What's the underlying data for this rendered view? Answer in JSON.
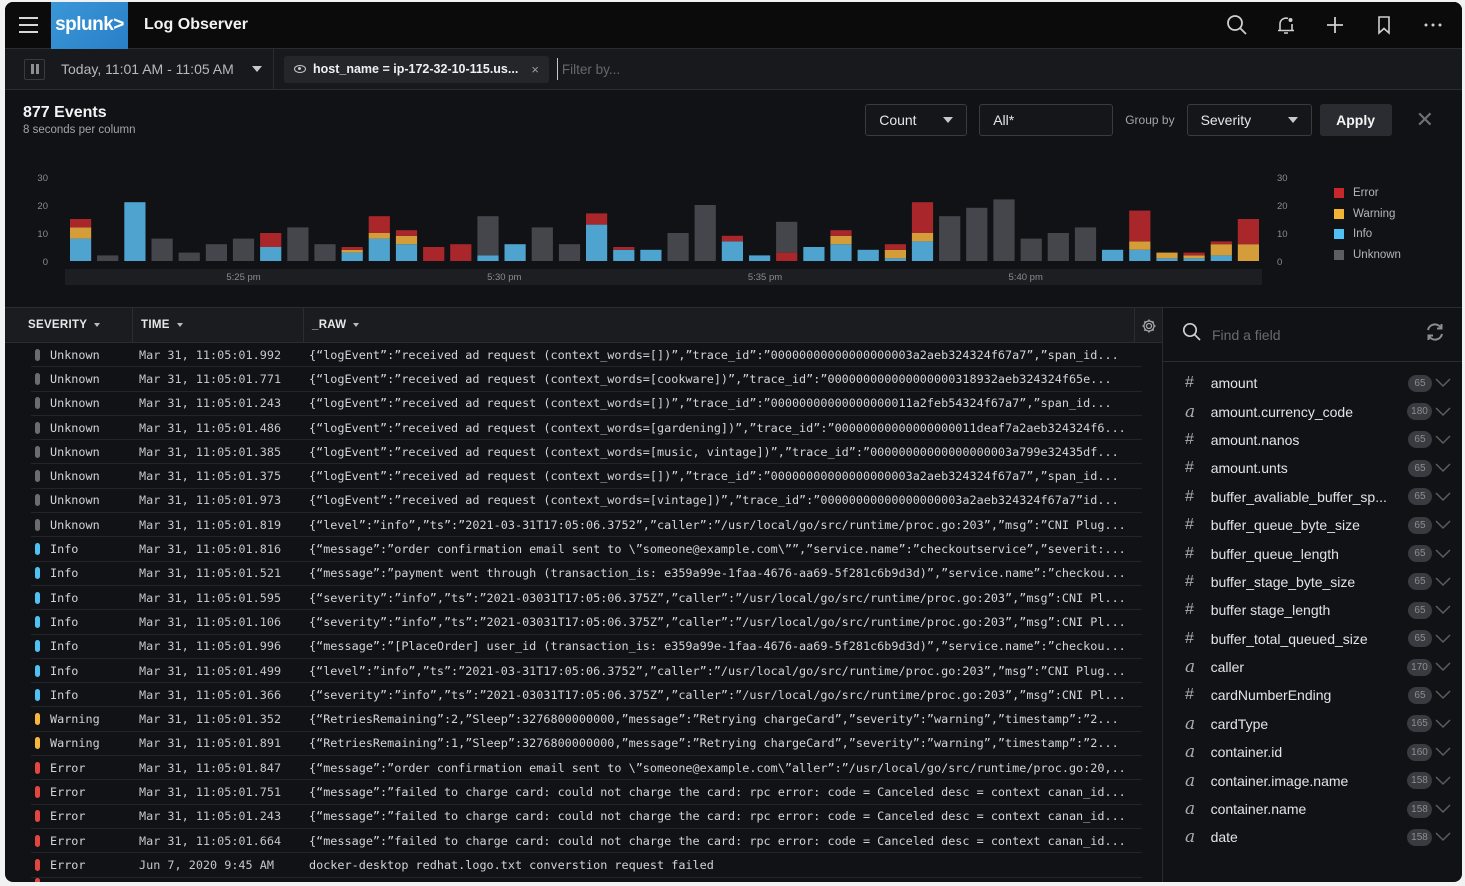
{
  "app": {
    "brand": "splunk>",
    "title": "Log Observer",
    "icons": [
      "search-icon",
      "bell-icon",
      "plus-icon",
      "bookmark-icon",
      "more-icon"
    ]
  },
  "filterbar": {
    "time_range": "Today, 11:01 AM - 11:05 AM",
    "filter_pill": "host_name = ip-172-32-10-115.us...",
    "filter_placeholder": "Filter by..."
  },
  "summary": {
    "events": "877 Events",
    "interval": "8 seconds per column"
  },
  "controls": {
    "aggregate": "Count",
    "field": "All*",
    "group_by_label": "Group by",
    "group_by": "Severity",
    "apply_label": "Apply"
  },
  "colors": {
    "error": "#a9262a",
    "warning": "#d59c3a",
    "info": "#4fa3cf",
    "unknown": "#45464b",
    "error_dot": "#e5453f",
    "warning_dot": "#f6b73c",
    "info_dot": "#4fc1f2",
    "unknown_dot": "#6b6c70"
  },
  "chart_data": {
    "type": "bar",
    "stacked": true,
    "title": "",
    "xlabel": "",
    "ylabel": "",
    "ylim": [
      0,
      30
    ],
    "y_ticks": [
      0,
      10,
      20,
      30
    ],
    "x_tick_labels": [
      {
        "label": "5:25 pm",
        "index": 6.5
      },
      {
        "label": "5:30 pm",
        "index": 16.1
      },
      {
        "label": "5:35 pm",
        "index": 25.7
      },
      {
        "label": "5:40 pm",
        "index": 35.3
      }
    ],
    "grid": false,
    "legend_position": "right",
    "legend": [
      "Error",
      "Warning",
      "Info",
      "Unknown"
    ],
    "series": [
      {
        "name": "Info",
        "color_key": "info",
        "values": [
          8,
          0,
          21,
          0,
          0,
          0,
          0,
          5,
          0,
          0,
          3,
          8,
          6,
          0,
          0,
          2,
          6,
          0,
          0,
          13,
          4,
          4,
          0,
          0,
          7,
          2,
          0,
          5,
          6,
          4,
          1,
          7,
          0,
          0,
          0,
          0,
          0,
          0,
          4,
          4,
          1,
          1,
          2,
          0
        ]
      },
      {
        "name": "Warning",
        "color_key": "warning",
        "values": [
          4,
          0,
          0,
          0,
          0,
          0,
          0,
          0,
          0,
          0,
          1,
          2,
          3,
          0,
          0,
          0,
          0,
          0,
          0,
          0,
          0,
          0,
          0,
          0,
          0,
          0,
          0,
          0,
          3,
          0,
          3,
          3,
          0,
          0,
          0,
          0,
          0,
          0,
          0,
          3,
          2,
          1,
          4,
          6
        ]
      },
      {
        "name": "Error",
        "color_key": "error",
        "values": [
          3,
          0,
          0,
          0,
          0,
          0,
          0,
          5,
          0,
          0,
          1,
          6,
          2,
          5,
          6,
          0,
          0,
          0,
          0,
          4,
          1,
          0,
          0,
          0,
          2,
          0,
          3,
          0,
          2,
          0,
          2,
          11,
          0,
          0,
          0,
          0,
          0,
          0,
          0,
          11,
          0,
          1,
          1,
          9
        ]
      },
      {
        "name": "Unknown",
        "color_key": "unknown",
        "values": [
          0,
          2,
          0,
          8,
          3,
          6,
          8,
          0,
          12,
          6,
          0,
          0,
          0,
          0,
          0,
          14,
          0,
          12,
          6,
          0,
          0,
          0,
          10,
          20,
          0,
          0,
          11,
          0,
          0,
          0,
          0,
          0,
          16,
          19,
          22,
          8,
          10,
          12,
          0,
          0,
          0,
          0,
          0,
          0
        ]
      }
    ]
  },
  "table": {
    "columns": [
      "SEVERITY",
      "TIME",
      "_RAW"
    ],
    "rows": [
      {
        "severity": "Unknown",
        "time": "Mar 31, 11:05:01.992",
        "raw": "{“logEvent”:”received ad request (context_words=[])”,”trace_id”:”00000000000000000003a2aeb324324f67a7”,”span_id..."
      },
      {
        "severity": "Unknown",
        "time": "Mar 31, 11:05:01.771",
        "raw": "{“logEvent”:”received ad request (context_words=[cookware])”,”trace_id”:”000000000000000000318932aeb324324f65e..."
      },
      {
        "severity": "Unknown",
        "time": "Mar 31, 11:05:01.243",
        "raw": "{“logEvent”:”received ad request (context_words=[])”,”trace_id”:”00000000000000000011a2feb54324f67a7”,”span_id..."
      },
      {
        "severity": "Unknown",
        "time": "Mar 31, 11:05:01.486",
        "raw": "{“logEvent”:”received ad request (context_words=[gardening])”,”trace_id”:”00000000000000000011deaf7a2aeb324324f6..."
      },
      {
        "severity": "Unknown",
        "time": "Mar 31, 11:05:01.385",
        "raw": "{“logEvent”:”received ad request (context_words=[music, vintage])”,”trace_id”:”00000000000000000003a799e32435df..."
      },
      {
        "severity": "Unknown",
        "time": "Mar 31, 11:05:01.375",
        "raw": "{“logEvent”:”received ad request (context_words=[])”,”trace_id”:”00000000000000000003a2aeb324324f67a7”,”span_id..."
      },
      {
        "severity": "Unknown",
        "time": "Mar 31, 11:05:01.973",
        "raw": "{“logEvent”:”received ad request (context_words=[vintage])”,”trace_id”:”00000000000000000003a2aeb324324f67a7”id..."
      },
      {
        "severity": "Unknown",
        "time": "Mar 31, 11:05:01.819",
        "raw": "{“level”:”info”,”ts”:”2021-03-31T17:05:06.3752”,”caller”:”/usr/local/go/src/runtime/proc.go:203”,”msg”:”CNI Plug..."
      },
      {
        "severity": "Info",
        "time": "Mar 31, 11:05:01.816",
        "raw": "{“message”:”order confirmation email sent to \\”someone@example.com\\””,”service.name”:”checkoutservice”,”severit:..."
      },
      {
        "severity": "Info",
        "time": "Mar 31, 11:05:01.521",
        "raw": "{“message”:”payment went through (transaction_is: e359a99e-1faa-4676-aa69-5f281c6b9d3d)”,”service.name”:”checkou..."
      },
      {
        "severity": "Info",
        "time": "Mar 31, 11:05:01.595",
        "raw": "{“severity”:”info”,”ts”:”2021-03031T17:05:06.375Z”,”caller”:”/usr/local/go/src/runtime/proc.go:203”,”msg”:CNI Pl..."
      },
      {
        "severity": "Info",
        "time": "Mar 31, 11:05:01.106",
        "raw": "{“severity”:”info”,”ts”:”2021-03031T17:05:06.375Z”,”caller”:”/usr/local/go/src/runtime/proc.go:203”,”msg”:CNI Pl..."
      },
      {
        "severity": "Info",
        "time": "Mar 31, 11:05:01.996",
        "raw": "{“message”:”[PlaceOrder] user_id (transaction_is: e359a99e-1faa-4676-aa69-5f281c6b9d3d)”,”service.name”:”checkou..."
      },
      {
        "severity": "Info",
        "time": "Mar 31, 11:05:01.499",
        "raw": "{“level”:”info”,”ts”:”2021-03-31T17:05:06.3752”,”caller”:”/usr/local/go/src/runtime/proc.go:203”,”msg”:”CNI Plug..."
      },
      {
        "severity": "Info",
        "time": "Mar 31, 11:05:01.366",
        "raw": "{“severity”:”info”,”ts”:”2021-03031T17:05:06.375Z”,”caller”:”/usr/local/go/src/runtime/proc.go:203”,”msg”:CNI Pl..."
      },
      {
        "severity": "Warning",
        "time": "Mar 31, 11:05:01.352",
        "raw": "{“RetriesRemaining”:2,”Sleep”:3276800000000,”message”:”Retrying chargeCard”,”severity”:”warning”,”timestamp”:”2..."
      },
      {
        "severity": "Warning",
        "time": "Mar 31, 11:05:01.891",
        "raw": "{“RetriesRemaining”:1,”Sleep”:3276800000000,”message”:”Retrying chargeCard”,”severity”:”warning”,”timestamp”:”2..."
      },
      {
        "severity": "Error",
        "time": "Mar 31, 11:05:01.847",
        "raw": "{“message”:”order confirmation email sent to \\”someone@example.com\\”aller”:”/usr/local/go/src/runtime/proc.go:20,.."
      },
      {
        "severity": "Error",
        "time": "Mar 31, 11:05:01.751",
        "raw": "{“message”:”failed to charge card: could not charge the card: rpc error: code = Canceled desc = context canan_id..."
      },
      {
        "severity": "Error",
        "time": "Mar 31, 11:05:01.243",
        "raw": "{“message”:”failed to charge card: could not charge the card: rpc error: code = Canceled desc = context canan_id..."
      },
      {
        "severity": "Error",
        "time": "Mar 31, 11:05:01.664",
        "raw": "{“message”:”failed to charge card: could not charge the card: rpc error: code = Canceled desc = context canan_id..."
      },
      {
        "severity": "Error",
        "time": "Jun 7, 2020 9:45 AM",
        "raw": "docker-desktop    redhat.logo.txt    converstion request failed"
      }
    ]
  },
  "fields_panel": {
    "search_placeholder": "Find a field",
    "fields": [
      {
        "type": "number",
        "name": "amount",
        "count": "65"
      },
      {
        "type": "string",
        "name": "amount.currency_code",
        "count": "180"
      },
      {
        "type": "number",
        "name": "amount.nanos",
        "count": "65"
      },
      {
        "type": "number",
        "name": "amount.unts",
        "count": "65"
      },
      {
        "type": "number",
        "name": "buffer_avaliable_buffer_sp...",
        "count": "65"
      },
      {
        "type": "number",
        "name": "buffer_queue_byte_size",
        "count": "65"
      },
      {
        "type": "number",
        "name": "buffer_queue_length",
        "count": "65"
      },
      {
        "type": "number",
        "name": "buffer_stage_byte_size",
        "count": "65"
      },
      {
        "type": "number",
        "name": "buffer stage_length",
        "count": "65"
      },
      {
        "type": "number",
        "name": "buffer_total_queued_size",
        "count": "65"
      },
      {
        "type": "string",
        "name": "caller",
        "count": "170"
      },
      {
        "type": "number",
        "name": "cardNumberEnding",
        "count": "65"
      },
      {
        "type": "string",
        "name": "cardType",
        "count": "165"
      },
      {
        "type": "string",
        "name": "container.id",
        "count": "160"
      },
      {
        "type": "string",
        "name": "container.image.name",
        "count": "158"
      },
      {
        "type": "string",
        "name": "container.name",
        "count": "158"
      },
      {
        "type": "string",
        "name": "date",
        "count": "158"
      }
    ],
    "type_glyphs": {
      "number": "#",
      "string": "a"
    }
  }
}
